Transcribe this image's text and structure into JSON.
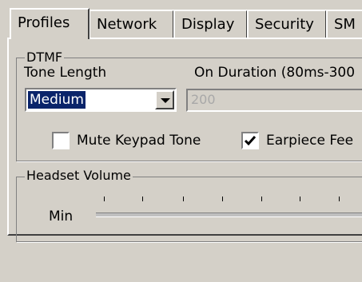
{
  "tabs": [
    {
      "label": "Profiles",
      "active": true
    },
    {
      "label": "Network",
      "active": false
    },
    {
      "label": "Display",
      "active": false
    },
    {
      "label": "Security",
      "active": false
    },
    {
      "label": "SM",
      "active": false
    }
  ],
  "dtmf": {
    "legend": "DTMF",
    "tone_length_label": "Tone Length",
    "tone_length_value": "Medium",
    "on_duration_label": "On Duration (80ms-300",
    "on_duration_value": "200",
    "mute_keypad_label": "Mute Keypad Tone",
    "mute_keypad_checked": false,
    "earpiece_label": "Earpiece Fee",
    "earpiece_checked": true
  },
  "headset": {
    "legend": "Headset Volume",
    "min_label": "Min"
  },
  "colors": {
    "face": "#d4d0c8",
    "highlight": "#0a246a"
  }
}
